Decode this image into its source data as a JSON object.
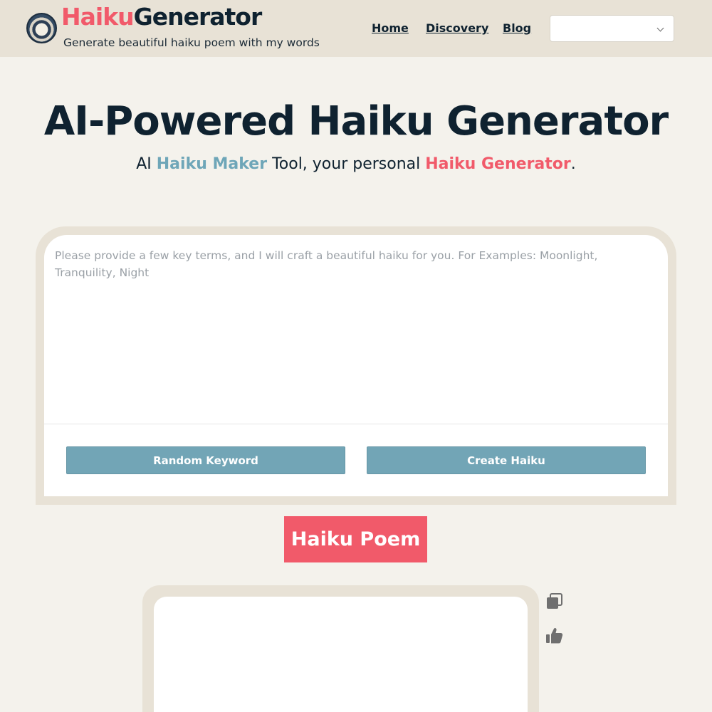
{
  "header": {
    "brand_part1": "Haiku",
    "brand_part2": "Generator",
    "tagline": "Generate beautiful haiku poem with my words",
    "nav": [
      {
        "label": "Home"
      },
      {
        "label": "Discovery"
      },
      {
        "label": "Blog"
      }
    ],
    "language_select_value": ""
  },
  "hero": {
    "title": "AI-Powered Haiku Generator",
    "subtitle_part1": "AI ",
    "subtitle_highlight1": "Haiku Maker",
    "subtitle_part2": " Tool, your personal ",
    "subtitle_highlight2": "Haiku Generator",
    "subtitle_part3": "."
  },
  "form": {
    "placeholder": "Please provide a few key terms, and I will craft a beautiful haiku for you. For Examples: Moonlight, Tranquility, Night",
    "value": "",
    "random_button": "Random Keyword",
    "create_button": "Create Haiku"
  },
  "result": {
    "badge": "Haiku Poem",
    "poem_text": ""
  },
  "icons": {
    "logo": "haiku-wave-logo-icon",
    "copy": "copy-icon",
    "like": "thumbs-up-icon",
    "dropdown": "chevron-down-icon"
  },
  "colors": {
    "brand_pink": "#f15a6a",
    "brand_blue": "#6ea6b8",
    "button": "#72a5b6",
    "header_bg": "#e8e2d6",
    "page_bg": "#f4f2ec",
    "dark_text": "#0f2230"
  }
}
